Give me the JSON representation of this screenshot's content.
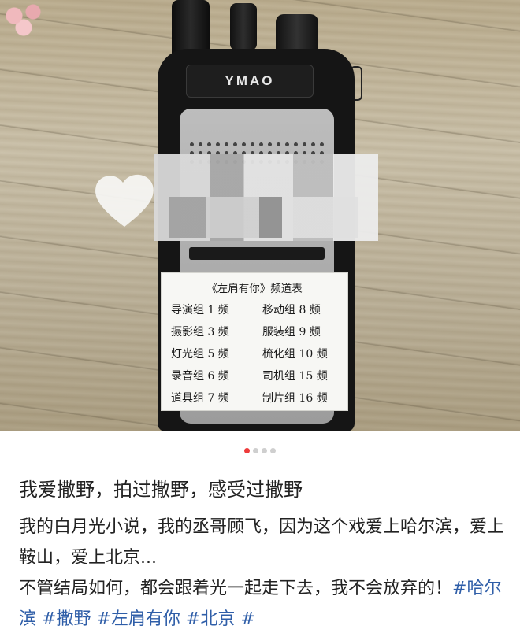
{
  "photo": {
    "brand": "YMAO",
    "sticker": {
      "title": "《左肩有你》频道表",
      "channels": [
        {
          "left": "导演组 1 频",
          "right": "移动组 8 频"
        },
        {
          "left": "摄影组 3 频",
          "right": "服装组 9 频"
        },
        {
          "left": "灯光组 5 频",
          "right": "梳化组 10 频"
        },
        {
          "left": "录音组 6 频",
          "right": "司机组 15 频"
        },
        {
          "left": "道具组 7 频",
          "right": "制片组 16 频"
        }
      ]
    }
  },
  "carousel": {
    "count": 4,
    "active_index": 0,
    "active_color": "#ee3b3b"
  },
  "post": {
    "title": "我爱撒野，拍过撒野，感受过撒野",
    "line1": "我的白月光小说，我的丞哥顾飞，因为这个戏爱上哈尔滨，爱上鞍山，爱上北京...",
    "line2_text": "不管结局如何，都会跟着光一起走下去，我不会放弃的！",
    "hashtags": [
      "#哈尔滨",
      "#撒野",
      "#左肩有你",
      "#北京",
      "#"
    ],
    "hashtag_color": "#2f5ea8"
  }
}
